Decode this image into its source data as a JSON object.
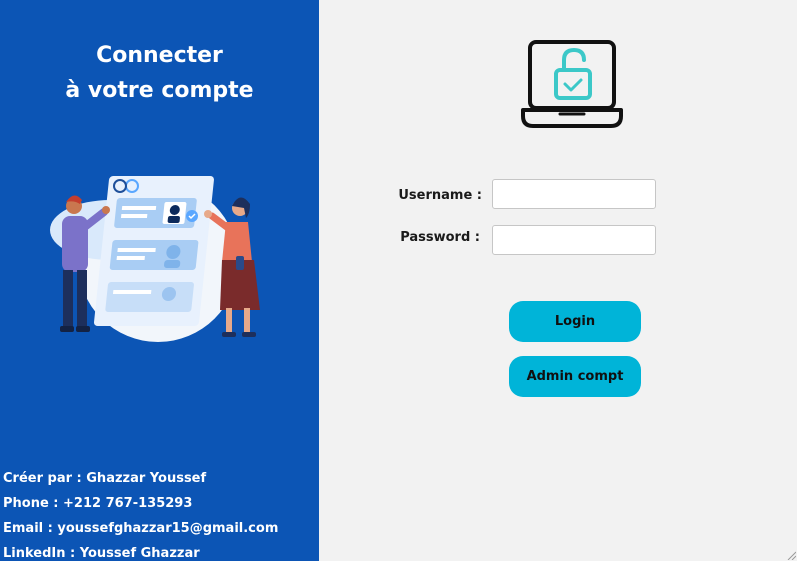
{
  "left_panel": {
    "title_line1": "Connecter",
    "title_line2": "à votre compte",
    "illustration": "people-with-profile-cards-illustration",
    "info": {
      "created_by": "Créer par : Ghazzar Youssef",
      "phone": "Phone : +212 767-135293",
      "email": "Email : youssefghazzar15@gmail.com",
      "linkedin": "LinkedIn : Youssef Ghazzar"
    }
  },
  "right_panel": {
    "logo": "laptop-unlocked-padlock-icon",
    "username": {
      "label": "Username :",
      "value": "",
      "placeholder": ""
    },
    "password": {
      "label": "Password :",
      "value": "",
      "placeholder": ""
    },
    "buttons": {
      "login": "Login",
      "admin": "Admin compt"
    }
  },
  "colors": {
    "left_panel_bg": "#0c55b5",
    "right_panel_bg": "#f2f2f2",
    "button_bg": "#00b4d8",
    "lock_icon": "#3cc8c8"
  }
}
